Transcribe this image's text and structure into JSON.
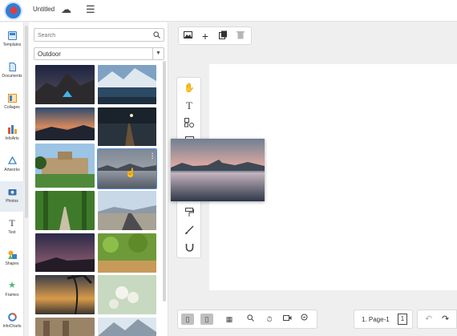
{
  "header": {
    "title": "Untitled",
    "cloud_icon": "cloud-sync-icon",
    "menu_icon": "hamburger-menu-icon"
  },
  "rail": {
    "items": [
      {
        "label": "Templates",
        "icon": "templates-icon"
      },
      {
        "label": "Documents",
        "icon": "documents-icon"
      },
      {
        "label": "Collages",
        "icon": "collages-icon"
      },
      {
        "label": "InfoArts",
        "icon": "infoarts-icon"
      },
      {
        "label": "Artworks",
        "icon": "artworks-icon"
      },
      {
        "label": "Photos",
        "icon": "photos-icon",
        "active": true
      },
      {
        "label": "Text",
        "icon": "text-icon"
      },
      {
        "label": "Shapes",
        "icon": "shapes-icon"
      },
      {
        "label": "Frames",
        "icon": "frames-icon"
      },
      {
        "label": "InfoCharts",
        "icon": "infocharts-icon"
      }
    ]
  },
  "panel": {
    "search_placeholder": "Search",
    "category": "Outdoor"
  },
  "pager": {
    "label": "1. Page-1",
    "count": "1"
  },
  "colors": {
    "accent": "#2f7fd6",
    "selection": "#5a8fd8"
  }
}
